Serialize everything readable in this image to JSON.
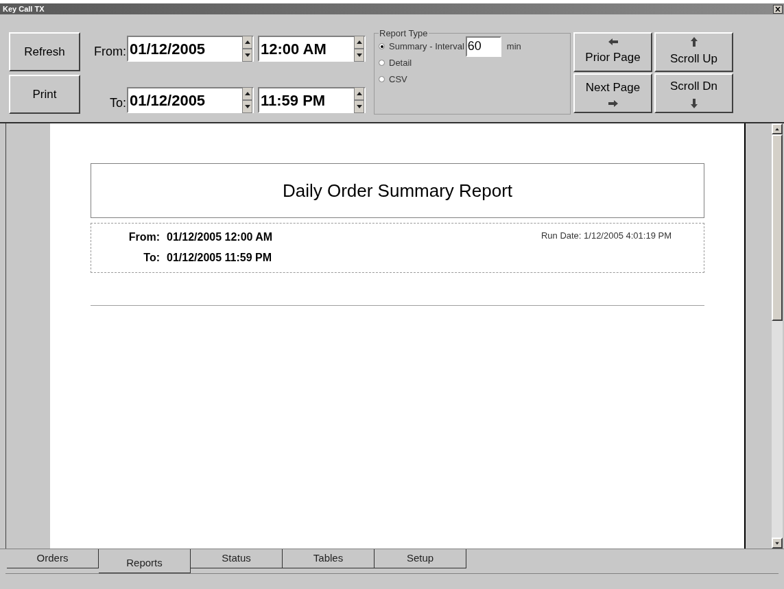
{
  "window": {
    "title": "Key Call TX"
  },
  "actions": [
    {
      "label": "Refresh"
    },
    {
      "label": "Print"
    }
  ],
  "range": [
    {
      "label": "From:",
      "date": "01/12/2005",
      "time": "12:00 AM"
    },
    {
      "label": "To:",
      "date": "01/12/2005",
      "time": "11:59 PM"
    }
  ],
  "report_type": {
    "legend": "Report Type",
    "interval_value": "60",
    "interval_unit": "min",
    "options": [
      {
        "label": "Summary - Interval",
        "selected": true
      },
      {
        "label": "Detail",
        "selected": false
      },
      {
        "label": "CSV",
        "selected": false
      }
    ]
  },
  "nav_buttons": [
    {
      "label": "Prior Page",
      "kind": "left"
    },
    {
      "label": "Scroll Up",
      "kind": "up"
    },
    {
      "label": "Next Page",
      "kind": "right"
    },
    {
      "label": "Scroll Dn",
      "kind": "down"
    }
  ],
  "report": {
    "title": "Daily Order Summary Report",
    "rows": [
      {
        "label": "From:",
        "value": "01/12/2005 12:00 AM"
      },
      {
        "label": "To:",
        "value": "01/12/2005 11:59 PM"
      }
    ],
    "run_date": "Run Date: 1/12/2005 4:01:19 PM"
  },
  "tabs": [
    {
      "label": "Orders",
      "selected": false
    },
    {
      "label": "Reports",
      "selected": true
    },
    {
      "label": "Status",
      "selected": false
    },
    {
      "label": "Tables",
      "selected": false
    },
    {
      "label": "Setup",
      "selected": false
    }
  ]
}
